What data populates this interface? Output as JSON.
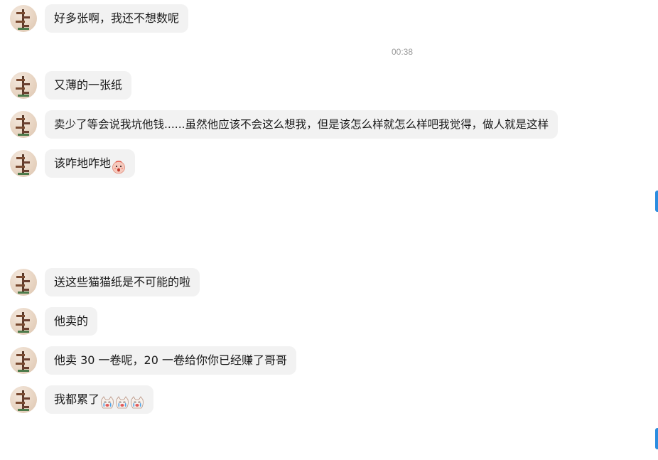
{
  "chat": {
    "timestamp": "00:38",
    "messages": [
      {
        "text": "好多张啊，我还不想数呢"
      },
      {
        "text": "又薄的一张纸"
      },
      {
        "text": "卖少了等会说我坑他钱......虽然他应该不会这么想我，但是该怎么样就怎么样吧我觉得，做人就是这样"
      },
      {
        "text": "该咋地咋地",
        "emoji": "surprised-face-icon"
      },
      {
        "text": "送这些猫猫纸是不可能的啦"
      },
      {
        "text": "他卖的"
      },
      {
        "text": "他卖 30 一卷呢，20 一卷给你你已经赚了哥哥"
      },
      {
        "text": "我都累了",
        "emoji": "crying-cat-icon x3"
      }
    ]
  },
  "colors": {
    "bubble": "#f2f2f2",
    "text": "#1a1a1a",
    "timestamp": "#9a9a9a",
    "indicator": "#2b8de0"
  }
}
